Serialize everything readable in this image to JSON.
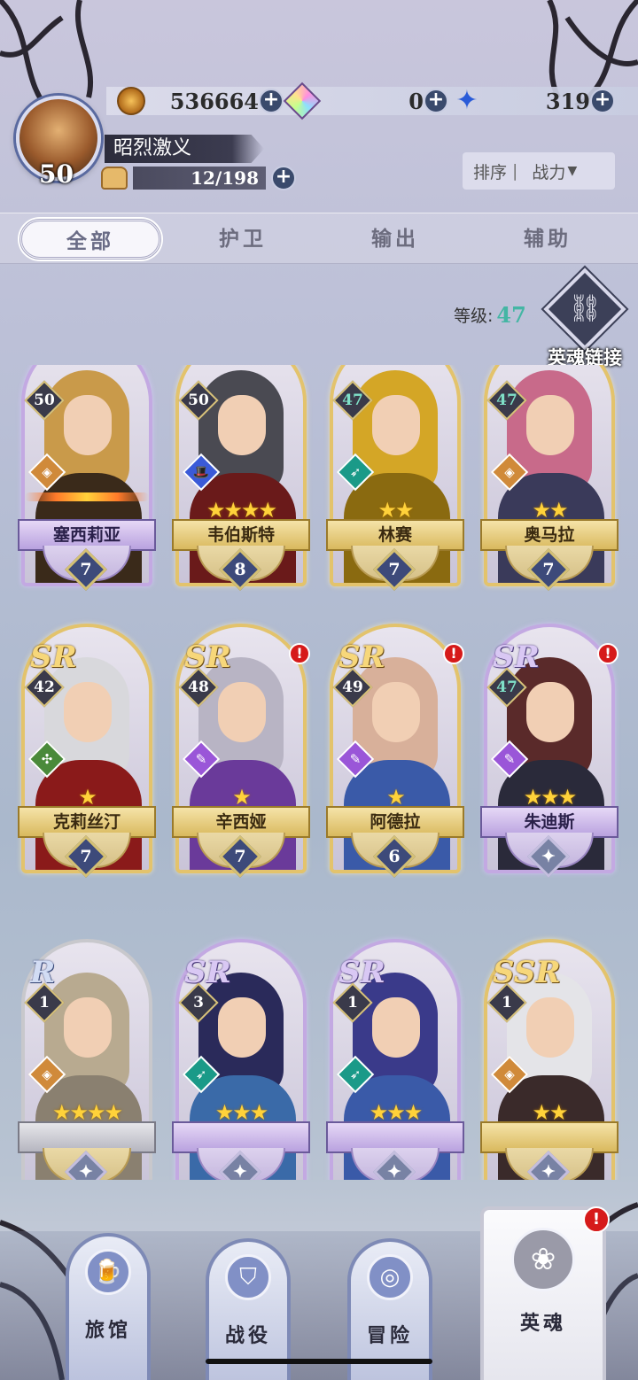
{
  "player": {
    "level": "50",
    "name": "昭烈激义",
    "stamina": "12/198"
  },
  "resources": [
    {
      "icon": "coin-icon",
      "value": "536664"
    },
    {
      "icon": "rainbow-gem-icon",
      "value": "0"
    },
    {
      "icon": "blue-star-icon",
      "value": "319"
    }
  ],
  "sort": {
    "label": "排序",
    "separator": "|",
    "value": "战力"
  },
  "tabs": [
    "全部",
    "护卫",
    "输出",
    "辅助"
  ],
  "active_tab": 0,
  "level_filter": {
    "label": "等级:",
    "value": "47"
  },
  "soul_link": {
    "label": "英魂链接"
  },
  "heroes": [
    {
      "name": "塞西莉亚",
      "level": "50",
      "rank": "7",
      "stars": 0,
      "rarity": "",
      "frame": "purple",
      "role": "orange",
      "alert": false
    },
    {
      "name": "韦伯斯特",
      "level": "50",
      "rank": "8",
      "stars": 4,
      "rarity": "",
      "frame": "gold",
      "role": "blue",
      "alert": false
    },
    {
      "name": "林赛",
      "level": "47",
      "rank": "7",
      "stars": 2,
      "rarity": "",
      "frame": "gold",
      "role": "teal",
      "alert": false
    },
    {
      "name": "奥马拉",
      "level": "47",
      "rank": "7",
      "stars": 2,
      "rarity": "",
      "frame": "gold",
      "role": "orange",
      "alert": false
    },
    {
      "name": "克莉丝汀",
      "level": "42",
      "rank": "7",
      "stars": 1,
      "rarity": "SR",
      "frame": "gold",
      "role": "green",
      "alert": false
    },
    {
      "name": "辛西娅",
      "level": "48",
      "rank": "7",
      "stars": 1,
      "rarity": "SR",
      "frame": "gold",
      "role": "purple",
      "alert": true
    },
    {
      "name": "阿德拉",
      "level": "49",
      "rank": "6",
      "stars": 1,
      "rarity": "SR",
      "frame": "gold",
      "role": "purple",
      "alert": true
    },
    {
      "name": "朱迪斯",
      "level": "47",
      "rank": "",
      "stars": 3,
      "rarity": "SR",
      "frame": "purple",
      "role": "purple",
      "alert": true
    },
    {
      "name": "",
      "level": "1",
      "rank": "",
      "stars": 4,
      "rarity": "R",
      "frame": "grey",
      "role": "orange",
      "alert": false
    },
    {
      "name": "",
      "level": "3",
      "rank": "",
      "stars": 3,
      "rarity": "SR",
      "frame": "purple",
      "role": "teal",
      "alert": false
    },
    {
      "name": "",
      "level": "1",
      "rank": "",
      "stars": 3,
      "rarity": "SR",
      "frame": "purple",
      "role": "teal",
      "alert": false
    },
    {
      "name": "",
      "level": "1",
      "rank": "",
      "stars": 2,
      "rarity": "SSR",
      "frame": "gold",
      "role": "orange",
      "alert": false
    }
  ],
  "nav": [
    {
      "label": "旅馆",
      "icon": "tavern-mug-icon"
    },
    {
      "label": "战役",
      "icon": "campaign-shield-icon"
    },
    {
      "label": "冒险",
      "icon": "adventure-compass-icon"
    },
    {
      "label": "英魂",
      "icon": "hero-soul-icon",
      "active": true,
      "alert": true
    }
  ]
}
